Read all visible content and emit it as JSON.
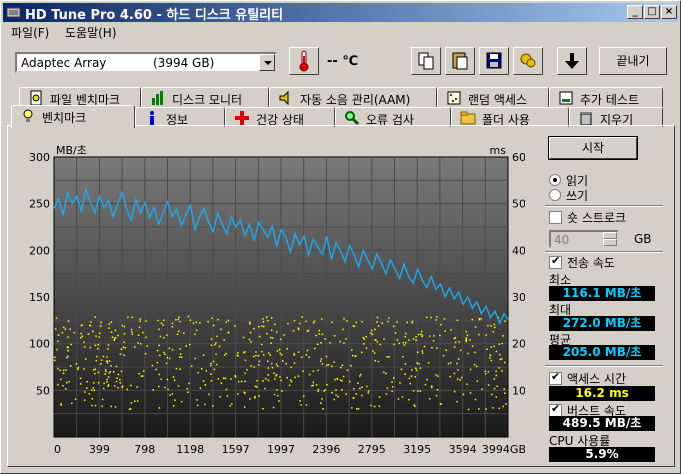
{
  "window": {
    "title": "HD Tune Pro 4.60 - 하드 디스크 유틸리티"
  },
  "menu": [
    "파일(F)",
    "도움말(H)"
  ],
  "toolbar": {
    "drive_name": "Adaptec Array",
    "drive_size": "(3994 GB)",
    "temperature": "-- ℃",
    "exit_label": "끝내기"
  },
  "tabs_row1": [
    {
      "label": "파일 벤치마크",
      "icon": "file-benchmark-icon"
    },
    {
      "label": "디스크 모니터",
      "icon": "disk-monitor-icon"
    },
    {
      "label": "자동 소음 관리(AAM)",
      "icon": "speaker-icon"
    },
    {
      "label": "랜덤 액세스",
      "icon": "random-access-icon"
    },
    {
      "label": "추가 테스트",
      "icon": "extra-tests-icon"
    }
  ],
  "tabs_row2": [
    {
      "label": "벤치마크",
      "icon": "benchmark-icon",
      "active": true
    },
    {
      "label": "정보",
      "icon": "info-icon"
    },
    {
      "label": "건강 상태",
      "icon": "health-icon"
    },
    {
      "label": "오류 검사",
      "icon": "error-scan-icon"
    },
    {
      "label": "폴더 사용",
      "icon": "folder-usage-icon"
    },
    {
      "label": "지우기",
      "icon": "erase-icon"
    }
  ],
  "side": {
    "start_label": "시작",
    "read_label": "읽기",
    "write_label": "쓰기",
    "mode": "read",
    "short_stroke_label": "숏 스트로크",
    "short_stroke_checked": false,
    "short_stroke_value": "40",
    "short_stroke_unit": "GB",
    "transfer_rate_label": "전송 속도",
    "transfer_rate_checked": true,
    "min_label": "최소",
    "min_value": "116.1 MB/초",
    "max_label": "최대",
    "max_value": "272.0 MB/초",
    "avg_label": "평균",
    "avg_value": "205.0 MB/초",
    "access_time_label": "액세스 시간",
    "access_time_checked": true,
    "access_time_value": "16.2 ms",
    "burst_label": "버스트 속도",
    "burst_checked": true,
    "burst_value": "489.5 MB/초",
    "cpu_label": "CPU 사용률",
    "cpu_value": "5.9%"
  },
  "chart_data": {
    "type": "line",
    "left_unit": "MB/초",
    "right_unit": "ms",
    "y_left_ticks": [
      "300",
      "250",
      "200",
      "150",
      "100",
      "50"
    ],
    "y_right_ticks": [
      "60",
      "50",
      "40",
      "30",
      "20",
      "10"
    ],
    "x_ticks": [
      "0",
      "399",
      "798",
      "1198",
      "1597",
      "1997",
      "2396",
      "2795",
      "3195",
      "3594",
      "3994GB"
    ],
    "xlim": [
      0,
      3994
    ],
    "ylim_left": [
      0,
      300
    ],
    "ylim_right": [
      0,
      60
    ],
    "grid": true,
    "series": [
      {
        "name": "전송 속도",
        "axis": "left",
        "color": "#1eaaee",
        "x": [
          0,
          40,
          80,
          120,
          160,
          200,
          240,
          280,
          320,
          360,
          400,
          440,
          480,
          520,
          560,
          600,
          640,
          680,
          720,
          760,
          800,
          840,
          880,
          920,
          960,
          1000,
          1040,
          1080,
          1120,
          1160,
          1200,
          1240,
          1280,
          1320,
          1360,
          1400,
          1440,
          1480,
          1520,
          1560,
          1600,
          1640,
          1680,
          1720,
          1760,
          1800,
          1840,
          1880,
          1920,
          1960,
          2000,
          2040,
          2080,
          2120,
          2160,
          2200,
          2240,
          2280,
          2320,
          2360,
          2400,
          2440,
          2480,
          2520,
          2560,
          2600,
          2640,
          2680,
          2720,
          2760,
          2800,
          2840,
          2880,
          2920,
          2960,
          3000,
          3040,
          3080,
          3120,
          3160,
          3200,
          3240,
          3280,
          3320,
          3360,
          3400,
          3440,
          3480,
          3520,
          3560,
          3600,
          3640,
          3680,
          3720,
          3760,
          3800,
          3840,
          3880,
          3920,
          3960,
          3994
        ],
        "values": [
          245,
          255,
          238,
          262,
          250,
          258,
          242,
          265,
          252,
          240,
          258,
          246,
          253,
          236,
          250,
          262,
          244,
          232,
          255,
          240,
          251,
          235,
          246,
          228,
          240,
          252,
          236,
          244,
          226,
          238,
          248,
          222,
          236,
          245,
          230,
          220,
          240,
          228,
          218,
          236,
          225,
          232,
          216,
          228,
          210,
          230,
          222,
          214,
          226,
          205,
          222,
          214,
          198,
          218,
          206,
          215,
          195,
          212,
          204,
          196,
          215,
          190,
          208,
          200,
          188,
          205,
          196,
          182,
          200,
          190,
          180,
          196,
          186,
          175,
          190,
          180,
          170,
          185,
          172,
          165,
          180,
          168,
          160,
          172,
          158,
          164,
          150,
          160,
          148,
          155,
          142,
          150,
          138,
          145,
          132,
          140,
          128,
          135,
          122,
          132,
          126
        ]
      }
    ],
    "scatter": {
      "name": "액세스 시간",
      "axis": "right",
      "color": "#ffff00",
      "range_ms": [
        6,
        26
      ]
    }
  }
}
